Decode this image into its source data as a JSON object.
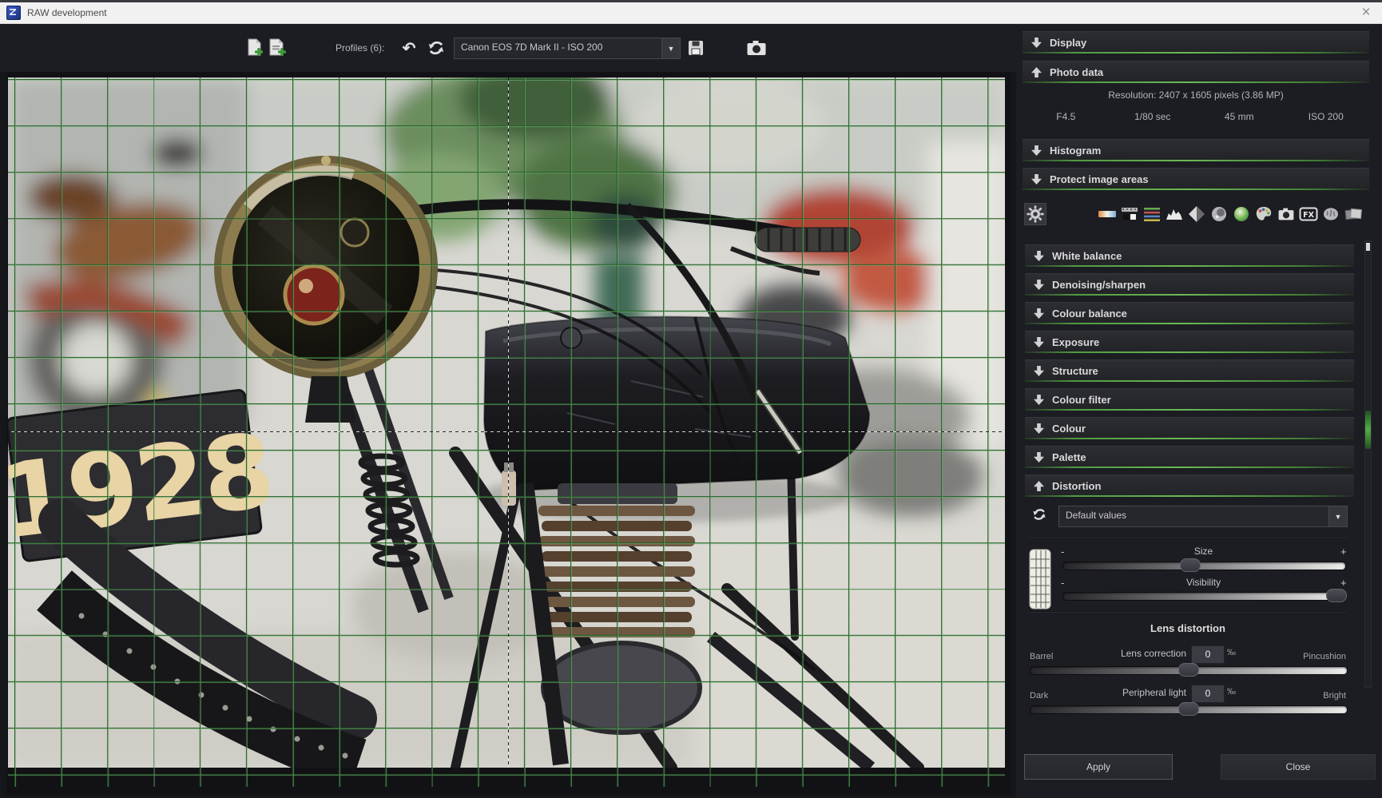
{
  "titlebar": {
    "title": "RAW development",
    "close_glyph": "×"
  },
  "toolbar": {
    "profiles_label": "Profiles (6):",
    "profile_value": "Canon EOS 7D Mark II - ISO 200",
    "dropdown_arrow_glyph": "▼",
    "undo_glyph": "↶",
    "icons": [
      "add-profile",
      "add-profile-with-settings",
      "undo",
      "reload-profile",
      "save-profile",
      "camera"
    ]
  },
  "photo": {
    "plate_text": "1928"
  },
  "sidebar": {
    "top_panels": [
      {
        "label": "Display",
        "state": "collapsed"
      },
      {
        "label": "Photo data",
        "state": "expanded"
      },
      {
        "label": "Histogram",
        "state": "collapsed"
      },
      {
        "label": "Protect image areas",
        "state": "collapsed"
      }
    ],
    "photo_data": {
      "resolution": "Resolution: 2407 x 1605 pixels (3.86 MP)",
      "aperture": "F4.5",
      "shutter_speed": "1/80 sec",
      "focal_length": "45 mm",
      "iso": "ISO 200"
    },
    "tool_icons": [
      "settings",
      "white-balance",
      "denoising-sharpen",
      "colour-balance",
      "exposure",
      "structure",
      "colour-filter",
      "colour",
      "palette",
      "camera",
      "effects-fx",
      "brain",
      "film-profiles"
    ],
    "fx_label": "FX",
    "panel_list": [
      {
        "label": "White balance",
        "state": "collapsed"
      },
      {
        "label": "Denoising/sharpen",
        "state": "collapsed"
      },
      {
        "label": "Colour balance",
        "state": "collapsed"
      },
      {
        "label": "Exposure",
        "state": "collapsed"
      },
      {
        "label": "Structure",
        "state": "collapsed"
      },
      {
        "label": "Colour filter",
        "state": "collapsed"
      },
      {
        "label": "Colour",
        "state": "collapsed"
      },
      {
        "label": "Palette",
        "state": "collapsed"
      },
      {
        "label": "Distortion",
        "state": "expanded"
      }
    ],
    "distortion": {
      "preset_value": "Default values",
      "minus_glyph": "-",
      "plus_glyph": "+",
      "size_label": "Size",
      "size_pct": 45,
      "visibility_label": "Visibility",
      "visibility_pct": 97,
      "lens_title": "Lens distortion",
      "lens_correction": {
        "label": "Lens correction",
        "value": "0",
        "unit": "‰",
        "min_label": "Barrel",
        "max_label": "Pincushion",
        "pct": 50
      },
      "peripheral_light": {
        "label": "Peripheral light",
        "value": "0",
        "unit": "‰",
        "min_label": "Dark",
        "max_label": "Bright",
        "pct": 50
      }
    },
    "footer": {
      "apply_label": "Apply",
      "close_label": "Close"
    },
    "accent_green": "#4e9a3e"
  }
}
